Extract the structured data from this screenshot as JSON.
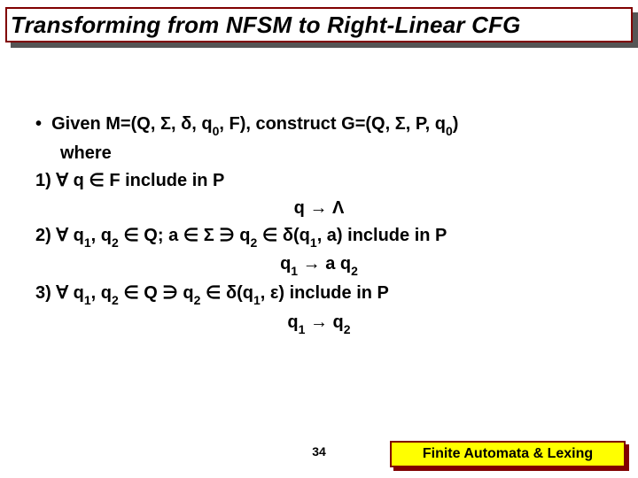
{
  "title": "Transforming from NFSM to Right-Linear CFG",
  "bullet1_a": "Given M=(Q, ",
  "bullet1_b": ", ",
  "bullet1_c": ", q",
  "bullet1_d": ", F), construct G=(Q, ",
  "bullet1_e": ", P, q",
  "bullet1_f": ")",
  "where": "where",
  "r1_a": "1) ",
  "r1_b": " q ",
  "r1_c": " F include in P",
  "r1_prod_a": "q ",
  "r1_prod_b": " ",
  "r2_a": "2) ",
  "r2_b": " q",
  "r2_c": ", q",
  "r2_d": " ",
  "r2_e": " Q; a ",
  "r2_f": " ",
  "r2_g": " ",
  "r2_h": " q",
  "r2_i": " ",
  "r2_j": " ",
  "r2_k": "(q",
  "r2_l": ", a) include in P",
  "r2_prod_a": "q",
  "r2_prod_b": " ",
  "r2_prod_c": " a q",
  "r3_a": "3) ",
  "r3_b": " q",
  "r3_c": ", q",
  "r3_d": " ",
  "r3_e": " Q ",
  "r3_f": " q",
  "r3_g": " ",
  "r3_h": " ",
  "r3_i": "(q",
  "r3_j": ", ",
  "r3_k": ") include in P",
  "r3_prod_a": "q",
  "r3_prod_b": " ",
  "r3_prod_c": " q",
  "sym": {
    "Sigma": "Σ",
    "delta": "δ",
    "forall": "∀",
    "elem": "∈",
    "arrow": "→",
    "Lambda": "Λ",
    "suchthat": "∋",
    "eps": "ε"
  },
  "idx": {
    "zero": "0",
    "one": "1",
    "two": "2"
  },
  "page": "34",
  "footer": "Finite Automata & Lexing"
}
